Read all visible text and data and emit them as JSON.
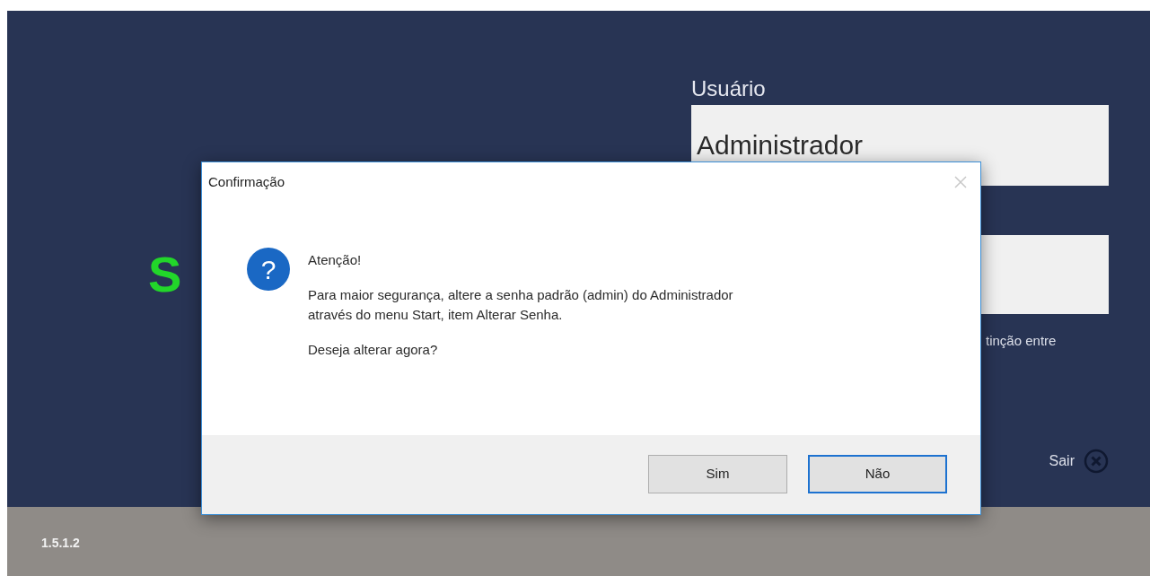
{
  "login": {
    "logo_text": "S",
    "user_label": "Usuário",
    "user_field": {
      "value": "Administrador"
    },
    "hint_fragment": "tinção entre",
    "exit_label": "Sair"
  },
  "footer": {
    "version": "1.5.1.2"
  },
  "dialog": {
    "title": "Confirmação",
    "icon": "?",
    "heading": "Atenção!",
    "message_lines": [
      "Para maior segurança, altere a senha padrão (admin) do Administrador",
      "através do menu Start, item Alterar Senha."
    ],
    "question": "Deseja alterar agora?",
    "buttons": [
      {
        "label": "Sim",
        "selected": false
      },
      {
        "label": "Não",
        "selected": true
      }
    ]
  }
}
